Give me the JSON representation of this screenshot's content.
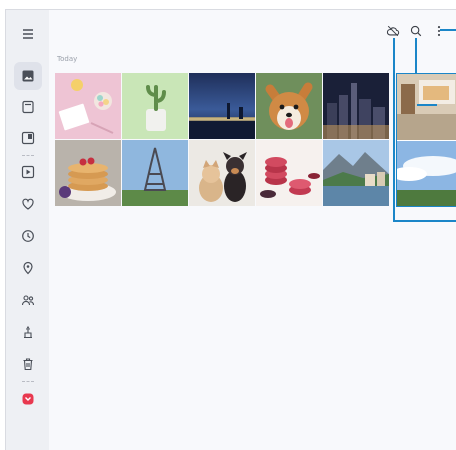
{
  "sidebar": {
    "items": [
      {
        "name": "menu-icon"
      },
      {
        "name": "pictures-icon",
        "active": true
      },
      {
        "name": "albums-icon"
      },
      {
        "name": "stories-icon"
      },
      {
        "name": "videos-icon"
      },
      {
        "name": "favorites-icon"
      },
      {
        "name": "recent-icon"
      },
      {
        "name": "locations-icon"
      },
      {
        "name": "shared-icon"
      },
      {
        "name": "suggestions-icon"
      },
      {
        "name": "trash-icon"
      },
      {
        "name": "app-badge-icon"
      }
    ]
  },
  "gallery": {
    "section_label": "Today",
    "photos": [
      {
        "name": "photo-desk-flatlay"
      },
      {
        "name": "photo-cactus-plant"
      },
      {
        "name": "photo-bridge-city-night"
      },
      {
        "name": "photo-corgi-dog"
      },
      {
        "name": "photo-skyline-night"
      },
      {
        "name": "photo-pancakes"
      },
      {
        "name": "photo-eiffel-tower"
      },
      {
        "name": "photo-kitten-and-puppy"
      },
      {
        "name": "photo-macarons"
      },
      {
        "name": "photo-lake-village"
      }
    ]
  },
  "toolbar": {
    "icons": [
      "cloud-off-icon",
      "search-icon",
      "more-options-icon"
    ]
  },
  "colors": {
    "accent": "#1b86c8",
    "sidebar_bg": "#eef0f4",
    "content_bg": "#f8f9fc"
  }
}
